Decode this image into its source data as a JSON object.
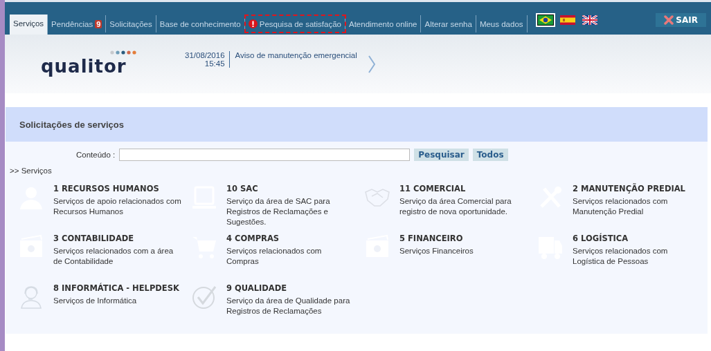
{
  "nav": {
    "tabs": [
      {
        "label": "Serviços",
        "selected": true
      },
      {
        "label": "Pendências",
        "selected": false,
        "badge": "9"
      },
      {
        "label": "Solicitações",
        "selected": false
      },
      {
        "label": "Base de conhecimento",
        "selected": false
      },
      {
        "label": "Pesquisa de satisfação",
        "selected": false,
        "alert": true
      },
      {
        "label": "Atendimento online",
        "selected": false
      },
      {
        "label": "Alterar senha",
        "selected": false
      },
      {
        "label": "Meus dados",
        "selected": false
      }
    ],
    "languages": [
      {
        "kind": "brazil",
        "selected": true
      },
      {
        "kind": "spain",
        "selected": false
      },
      {
        "kind": "uk",
        "selected": false
      }
    ],
    "logout": "SAIR"
  },
  "header": {
    "logo": "qualitor",
    "notice": {
      "date": "31/08/2016",
      "time": "15:45",
      "message": "Aviso de manutenção emergencial"
    }
  },
  "panel": {
    "title": "Solicitações de serviços",
    "search": {
      "label": "Conteúdo :",
      "buttons": [
        "Pesquisar",
        "Todos"
      ]
    },
    "breadcrumb": ">> Serviços",
    "services": [
      {
        "kind": "person",
        "title": "1 RECURSOS HUMANOS",
        "description": "Serviços de apoio relacionados com Recursos Humanos"
      },
      {
        "kind": "laptop",
        "title": "10 SAC",
        "description": "Serviço da área de SAC para Registros de Reclamações e Sugestões."
      },
      {
        "kind": "handshake",
        "title": "11 COMERCIAL",
        "description": "Serviço da área Comercial para registro de nova oportunidade."
      },
      {
        "kind": "tools",
        "title": "2 MANUTENÇÃO PREDIAL",
        "description": "Serviços relacionados com Manutenção Predial"
      },
      {
        "kind": "money",
        "title": "3 CONTABILIDADE",
        "description": "Serviços relacionados com a área de Contabilidade"
      },
      {
        "kind": "cart",
        "title": "4 COMPRAS",
        "description": "Serviços relacionados com Compras"
      },
      {
        "kind": "money",
        "title": "5 FINANCEIRO",
        "description": "Serviços Financeiros"
      },
      {
        "kind": "truck",
        "title": "6 LOGÍSTICA",
        "description": "Serviços relacionados com Logística de Pessoas"
      },
      {
        "kind": "headset",
        "title": "8 INFORMÁTICA - HELPDESK",
        "description": "Serviços de Informática"
      },
      {
        "kind": "check",
        "title": "9 QUALIDADE",
        "description": "Serviço da área de Qualidade para Registros de Reclamações"
      }
    ]
  }
}
